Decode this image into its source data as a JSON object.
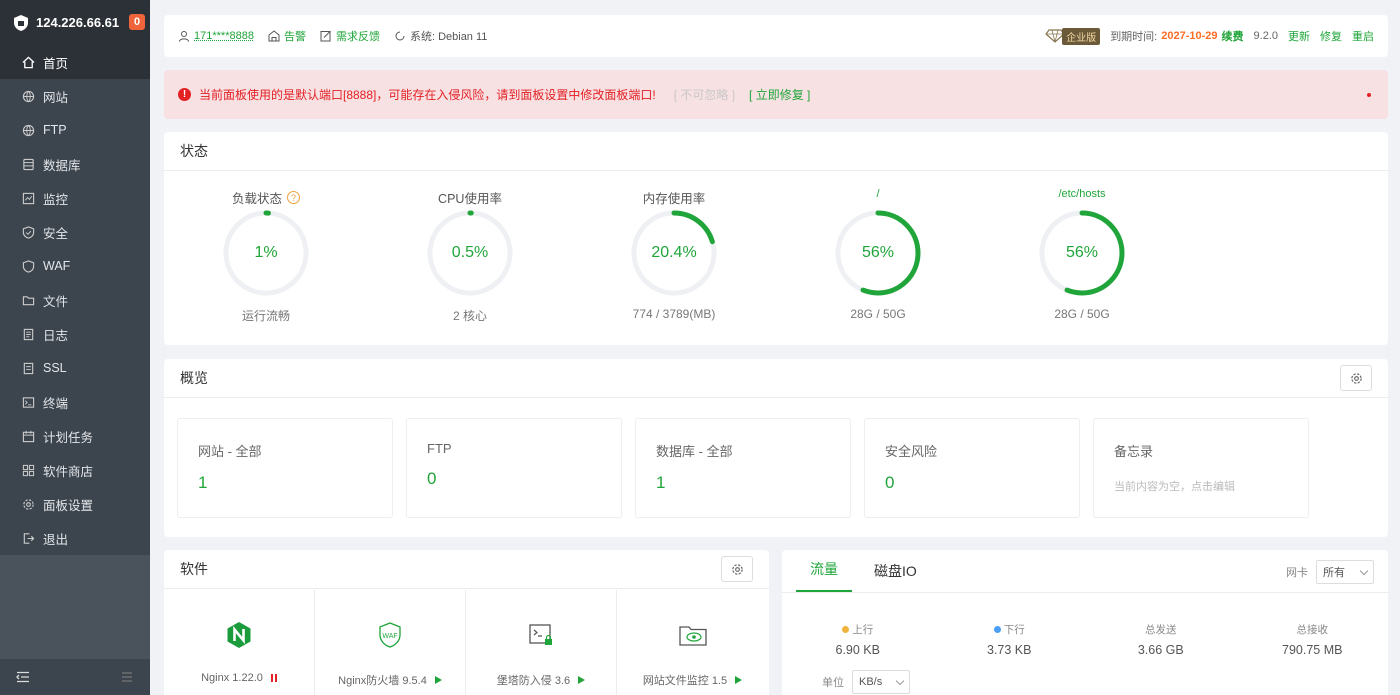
{
  "sidebar": {
    "server_ip": "124.226.66.61",
    "badge_count": "0",
    "items": [
      {
        "label": "首页",
        "icon": "home-icon"
      },
      {
        "label": "网站",
        "icon": "globe-icon"
      },
      {
        "label": "FTP",
        "icon": "globe-icon"
      },
      {
        "label": "数据库",
        "icon": "database-icon"
      },
      {
        "label": "监控",
        "icon": "monitor-icon"
      },
      {
        "label": "安全",
        "icon": "shield-icon"
      },
      {
        "label": "WAF",
        "icon": "waf-shield-icon"
      },
      {
        "label": "文件",
        "icon": "folder-icon"
      },
      {
        "label": "日志",
        "icon": "log-icon"
      },
      {
        "label": "SSL",
        "icon": "ssl-icon"
      },
      {
        "label": "终端",
        "icon": "terminal-icon"
      },
      {
        "label": "计划任务",
        "icon": "calendar-icon"
      },
      {
        "label": "软件商店",
        "icon": "apps-icon"
      },
      {
        "label": "面板设置",
        "icon": "gear-icon"
      },
      {
        "label": "退出",
        "icon": "logout-icon"
      }
    ]
  },
  "topbar": {
    "user": "171****8888",
    "alarm": "告警",
    "feedback": "需求反馈",
    "system": "系统:  Debian 11",
    "edition": "企业版",
    "expire_label": "到期时间:",
    "expire_date": "2027-10-29",
    "renew": "续费",
    "version": "9.2.0",
    "update": "更新",
    "repair": "修复",
    "restart": "重启"
  },
  "alert": {
    "message": "当前面板使用的是默认端口[8888]，可能存在入侵风险，请到面板设置中修改面板端口!",
    "ignore": "[ 不可忽略 ]",
    "fix": "[ 立即修复 ]"
  },
  "status": {
    "title": "状态",
    "gauges": [
      {
        "title": "负载状态",
        "value": "1%",
        "fraction": 0.01,
        "sub": "运行流畅"
      },
      {
        "title": "CPU使用率",
        "value": "0.5%",
        "fraction": 0.005,
        "sub": "2 核心"
      },
      {
        "title": "内存使用率",
        "value": "20.4%",
        "fraction": 0.204,
        "sub": "774 / 3789(MB)"
      },
      {
        "title": "/",
        "value": "56%",
        "fraction": 0.56,
        "sub": "28G / 50G"
      },
      {
        "title": "/etc/hosts",
        "value": "56%",
        "fraction": 0.56,
        "sub": "28G / 50G"
      }
    ]
  },
  "overview": {
    "title": "概览",
    "cards": [
      {
        "title": "网站 - 全部",
        "value": "1"
      },
      {
        "title": "FTP",
        "value": "0"
      },
      {
        "title": "数据库 - 全部",
        "value": "1"
      },
      {
        "title": "安全风险",
        "value": "0"
      }
    ],
    "memo_title": "备忘录",
    "memo_text": "当前内容为空，点击编辑"
  },
  "software": {
    "title": "软件",
    "items": [
      {
        "name": "Nginx 1.22.0",
        "icon": "nginx-icon",
        "state": "stopped"
      },
      {
        "name": "Nginx防火墙 9.5.4",
        "icon": "waf-icon",
        "state": "play"
      },
      {
        "name": "堡塔防入侵 3.6",
        "icon": "terminal-lock-icon",
        "state": "play"
      },
      {
        "name": "网站文件监控 1.5",
        "icon": "folder-eye-icon",
        "state": "play"
      }
    ]
  },
  "traffic": {
    "tabs": [
      "流量",
      "磁盘IO"
    ],
    "nic_label": "网卡",
    "nic_value": "所有",
    "stats": [
      {
        "label": "上行",
        "value": "6.90 KB",
        "dot": "#f0b43c"
      },
      {
        "label": "下行",
        "value": "3.73 KB",
        "dot": "#4a9ff5"
      },
      {
        "label": "总发送",
        "value": "3.66 GB",
        "dot": ""
      },
      {
        "label": "总接收",
        "value": "790.75 MB",
        "dot": ""
      }
    ],
    "unit_label": "单位",
    "unit_value": "KB/s"
  },
  "colors": {
    "accent": "#20a53a",
    "danger": "#e32024",
    "sidebar": "#3c444d"
  }
}
